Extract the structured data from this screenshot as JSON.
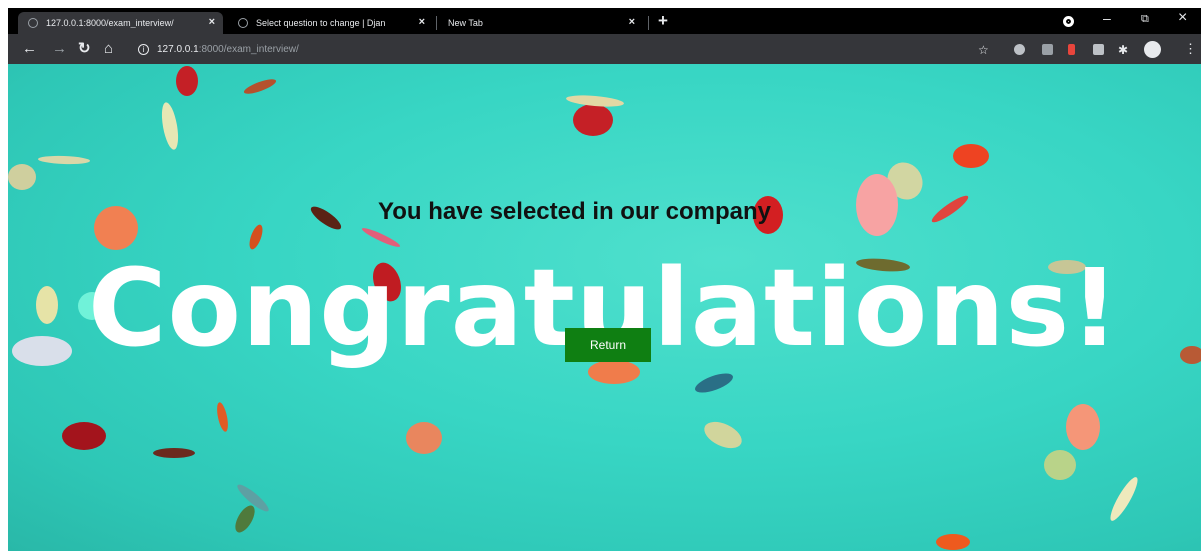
{
  "browser": {
    "tabs": [
      {
        "title": "127.0.0.1:8000/exam_interview/",
        "active": true
      },
      {
        "title": "Select question to change | Djan",
        "active": false
      },
      {
        "title": "New Tab",
        "active": false
      }
    ],
    "new_tab_symbol": "+",
    "close_symbol": "×",
    "window_controls": {
      "minimize": "–",
      "restore": "⧉",
      "close": "×"
    },
    "address": {
      "host": "127.0.0.1",
      "path": ":8000/exam_interview/"
    }
  },
  "page": {
    "subheading": "You have selected in our company",
    "hero": "Congratulations!",
    "return_button": "Return",
    "colors": {
      "background": "#38d6c4",
      "button": "#0f7f12",
      "hero_text": "#ffffff"
    }
  }
}
